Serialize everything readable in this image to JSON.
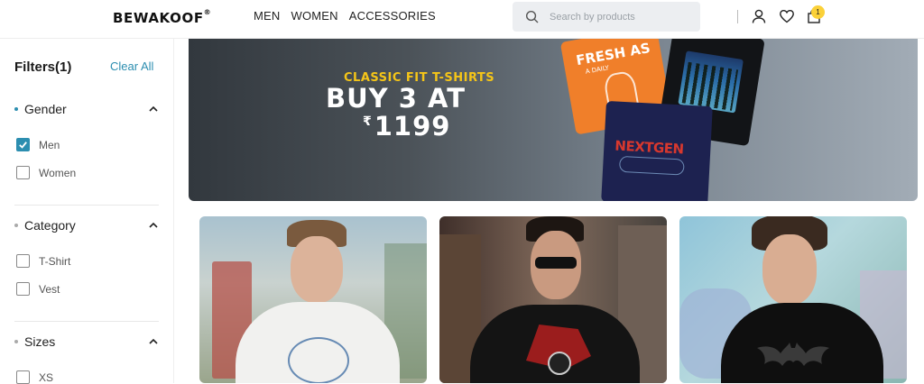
{
  "header": {
    "logo": "Bewakoof",
    "logo_mark": "®",
    "nav": [
      "MEN",
      "WOMEN",
      "ACCESSORIES"
    ],
    "search_placeholder": "Search by products",
    "cart_count": "1"
  },
  "sidebar": {
    "title": "Filters(1)",
    "clear_all": "Clear All",
    "sections": [
      {
        "label": "Gender",
        "options": [
          {
            "label": "Men",
            "checked": true
          },
          {
            "label": "Women",
            "checked": false
          }
        ]
      },
      {
        "label": "Category",
        "options": [
          {
            "label": "T-Shirt",
            "checked": false
          },
          {
            "label": "Vest",
            "checked": false
          }
        ]
      },
      {
        "label": "Sizes",
        "options": [
          {
            "label": "XS",
            "checked": false
          }
        ]
      }
    ]
  },
  "banner": {
    "subtitle": "CLASSIC FIT T-SHIRTS",
    "headline": "BUY 3 AT",
    "currency": "₹",
    "price": "1199",
    "tee_texts": [
      "FRESH AS",
      "A DAILY",
      "NEXTGEN"
    ]
  },
  "colors": {
    "accent": "#2c8eb0",
    "badge": "#fbd139",
    "banner_subtitle": "#f5c518"
  }
}
